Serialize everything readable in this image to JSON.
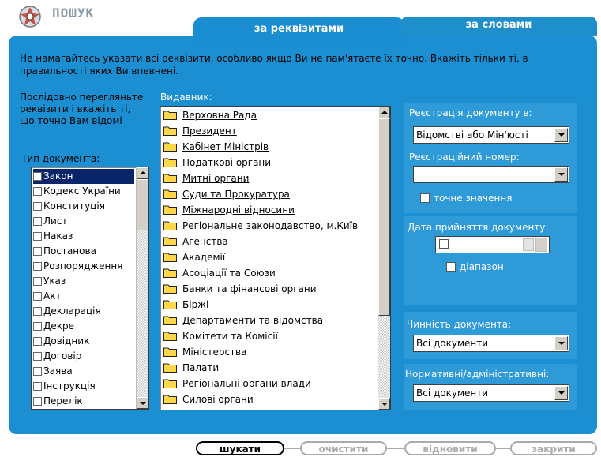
{
  "header": {
    "title": "ПОШУК"
  },
  "tabs": [
    {
      "label": "за реквізитами"
    },
    {
      "label": "за словами"
    }
  ],
  "intro": "Не намагайтесь указати всі реквізити, особливо якщо Ви не пам'ятаєте їх точно. Вкажіть тільки ті, в правильності яких Ви впевнені.",
  "side_hint": "Послідовно перегляньте реквізити і вкажіть ті, що точно Вам відомі",
  "doc_type": {
    "label": "Тип документа:",
    "items": [
      "Закон",
      "Кодекс України",
      "Конституція",
      "Лист",
      "Наказ",
      "Постанова",
      "Розпорядження",
      "Указ",
      "Акт",
      "Декларація",
      "Декрет",
      "Довідник",
      "Договір",
      "Заява",
      "Інструкція",
      "Перелік"
    ],
    "selected": "Закон"
  },
  "publisher": {
    "label": "Видавник:",
    "items": [
      "Верховна Рада",
      "Президент",
      "Кабінет Міністрів",
      "Податкові органи",
      "Митні органи",
      "Суди та Прокуратура",
      "Міжнародні відносини",
      "Регіональне законодавство, м.Київ",
      "Агенства",
      "Академії",
      "Асоціації та Союзи",
      "Банки та фінансові органи",
      "Біржі",
      "Департаменти та відомства",
      "Комітети та Комісії",
      "Міністерства",
      "Палати",
      "Регіональні органи влади",
      "Силові органи"
    ],
    "underlined_count": 8
  },
  "registration": {
    "label": "Реєстрація документу в:",
    "value": "Відомстві або Мін'юсті",
    "number_label": "Реєстраційний номер:",
    "number_value": "",
    "exact_label": "точне значення"
  },
  "adoption": {
    "label": "Дата прийняття документу:",
    "range_label": "діапазон"
  },
  "validity": {
    "label": "Чинність документа:",
    "value": "Всі документи"
  },
  "normative": {
    "label": "Нормативні/адміністративні:",
    "value": "Всі документи"
  },
  "buttons": {
    "search": "шукати",
    "clear": "очистити",
    "restore": "відновити",
    "close": "закрити"
  },
  "colors": {
    "panel": "#1b8fd2",
    "selection": "#0a246a",
    "folder": "#ffd84a"
  }
}
